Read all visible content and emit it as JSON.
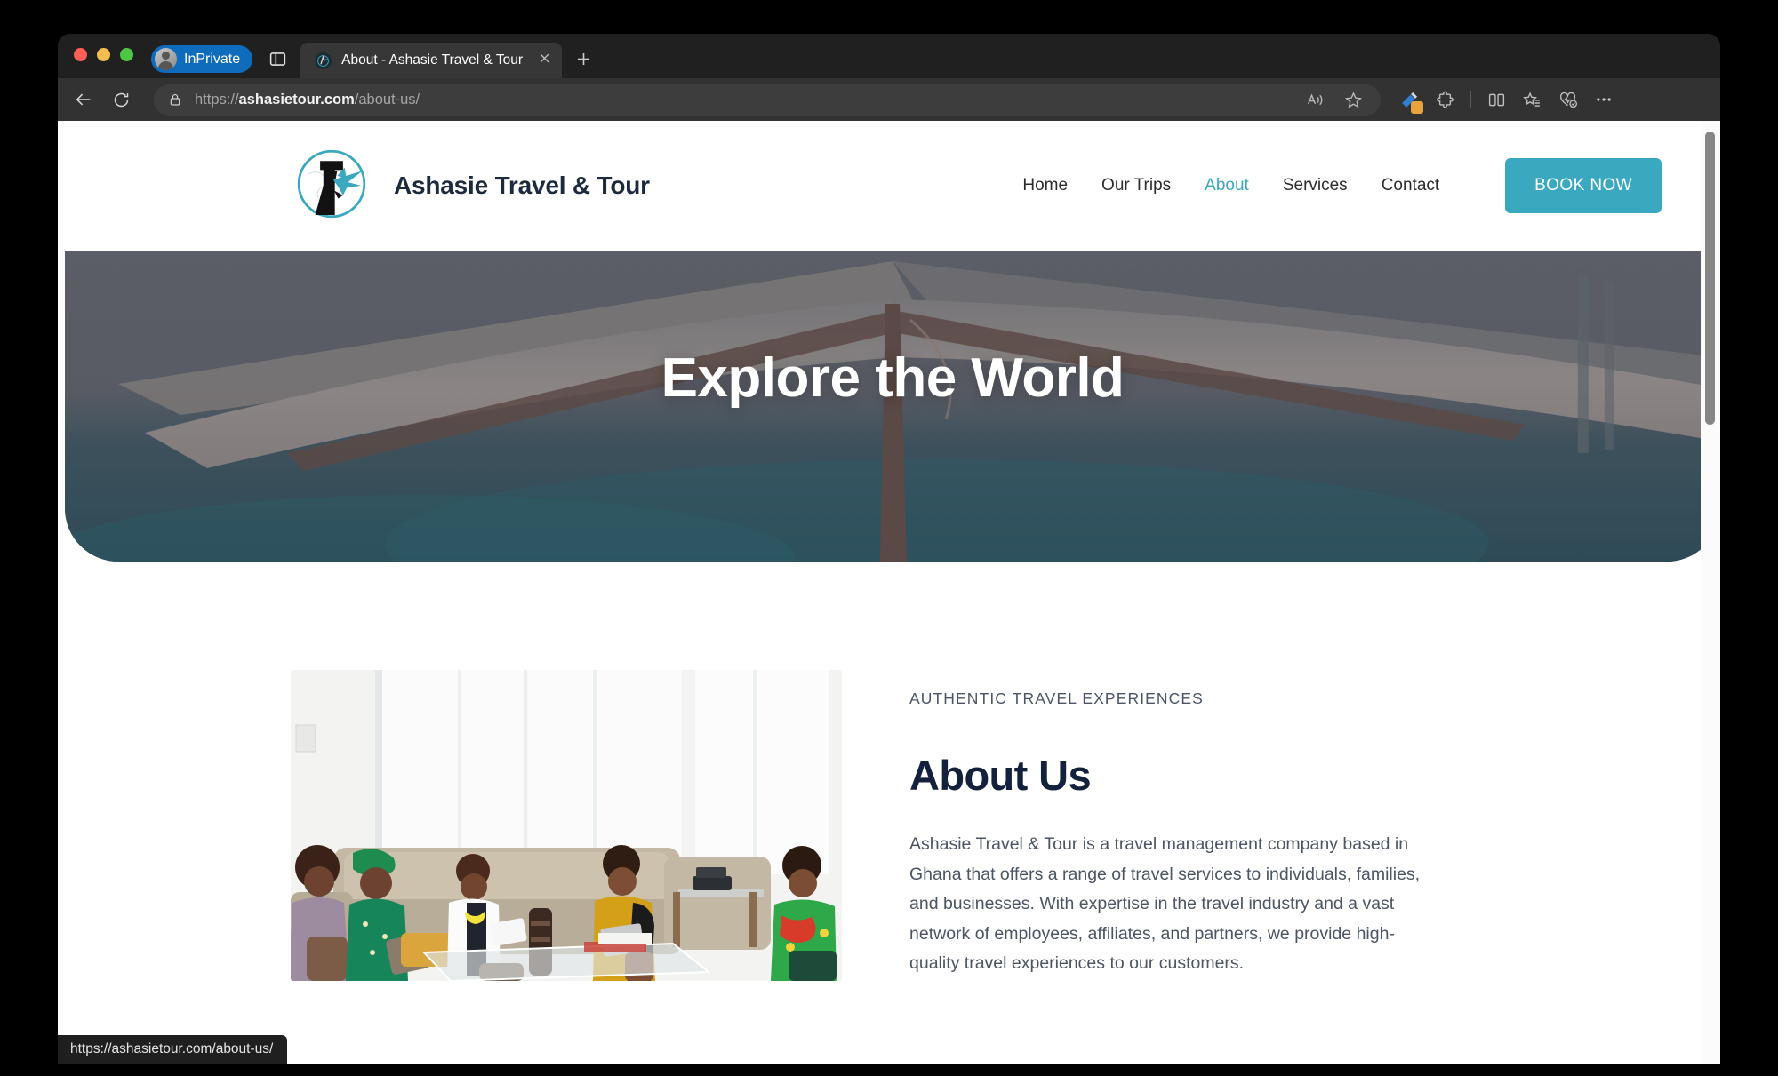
{
  "browser": {
    "window_controls": [
      "close",
      "minimize",
      "maximize"
    ],
    "profile_chip": "InPrivate",
    "profile_icon": "person-avatar-icon",
    "tab_search_icon": "tab-panel-icon",
    "tab": {
      "title": "About - Ashasie Travel & Tour",
      "favicon": "site-favicon",
      "close_icon": "close-icon"
    },
    "new_tab_icon": "plus-icon",
    "back_icon": "back-arrow-icon",
    "reload_icon": "reload-icon",
    "lock_icon": "lock-icon",
    "url_scheme": "https://",
    "url_domain": "ashasietour.com",
    "url_path": "/about-us/",
    "toolbar_icons": [
      "read-aloud-icon",
      "favorite-star-icon",
      "copilot-pen-icon",
      "extensions-puzzle-icon",
      "split-screen-icon",
      "collections-icon",
      "browser-essentials-icon",
      "settings-more-icon"
    ],
    "status_url": "https://ashasietour.com/about-us/"
  },
  "site": {
    "brand": {
      "name": "Ashasie Travel & Tour",
      "logo_icon": "globe-plane-logo"
    },
    "nav": [
      {
        "label": "Home",
        "active": false
      },
      {
        "label": "Our Trips",
        "active": false
      },
      {
        "label": "About",
        "active": true
      },
      {
        "label": "Services",
        "active": false
      },
      {
        "label": "Contact",
        "active": false
      }
    ],
    "cta": {
      "label": "BOOK NOW"
    },
    "hero": {
      "title": "Explore the World",
      "image_alt": "beach-umbrella-photo"
    },
    "about": {
      "eyebrow": "AUTHENTIC TRAVEL EXPERIENCES",
      "heading": "About Us",
      "paragraph": "Ashasie Travel & Tour is a travel management company based in Ghana that offers a range of travel services to individuals, families, and businesses. With expertise in the travel industry and a vast network of employees, affiliates, and partners, we provide high-quality travel experiences to our customers.",
      "image_alt": "office-lounge-team-photo"
    }
  },
  "colors": {
    "accent_teal": "#3aa8bf",
    "brand_dark": "#14213d",
    "body_text": "#4b5563",
    "chrome_dark": "#202020",
    "inprivate_blue": "#0f6cbd"
  }
}
